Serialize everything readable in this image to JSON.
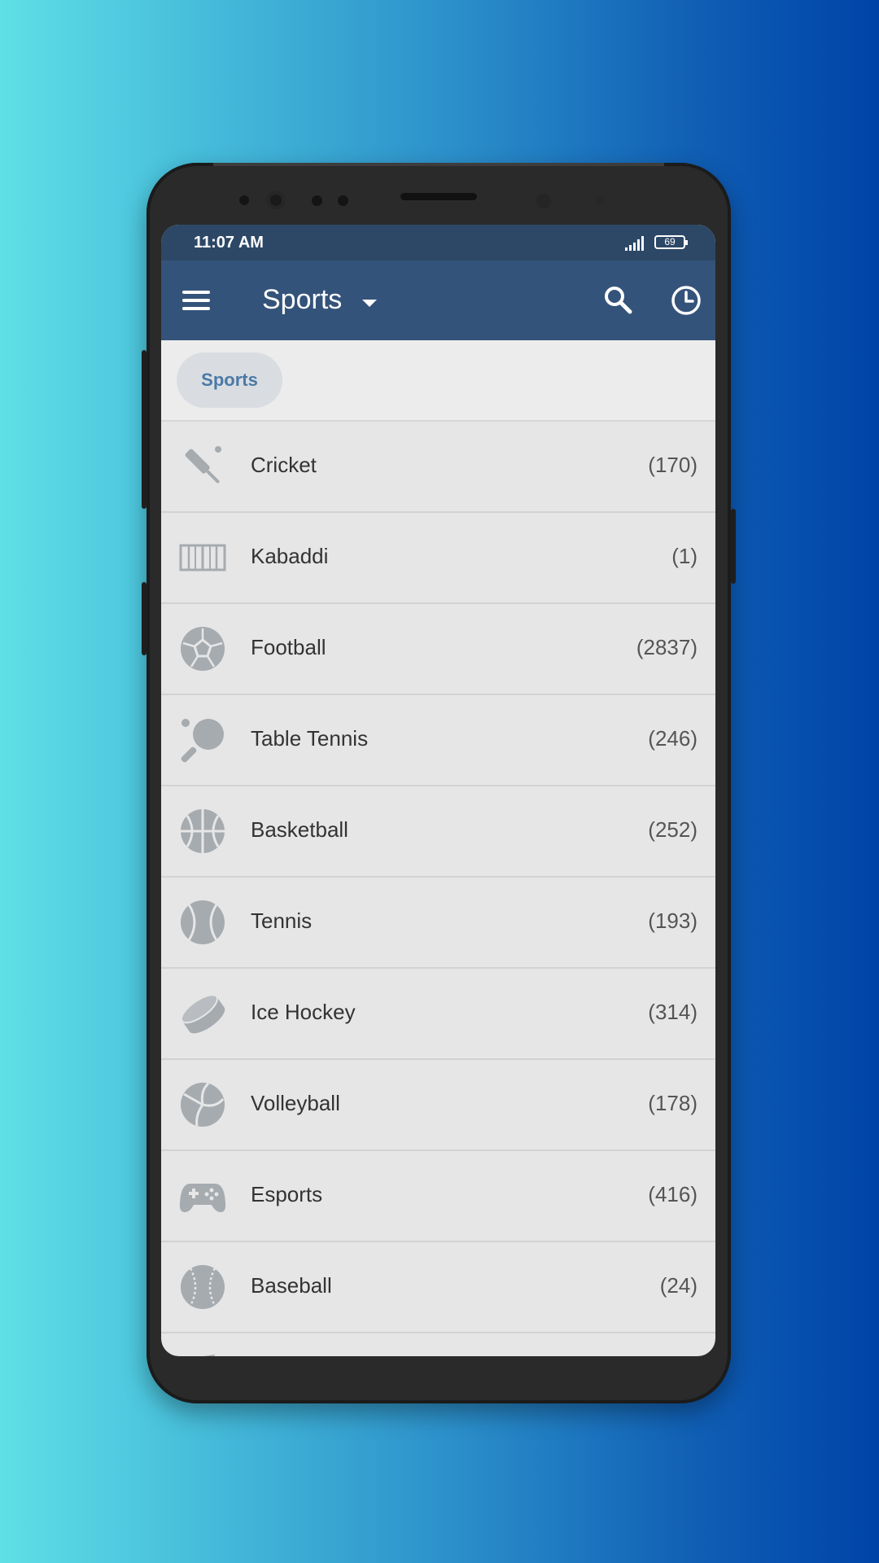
{
  "status_bar": {
    "time": "11:07 AM",
    "battery": "69"
  },
  "app_bar": {
    "title": "Sports",
    "icons": [
      "menu-icon",
      "chevron-down-icon",
      "search-icon",
      "history-icon"
    ]
  },
  "filter": {
    "chip_label": "Sports"
  },
  "sports": [
    {
      "name": "Cricket",
      "count": "(170)",
      "icon": "cricket-bat-icon"
    },
    {
      "name": "Kabaddi",
      "count": "(1)",
      "icon": "kabaddi-court-icon"
    },
    {
      "name": "Football",
      "count": "(2837)",
      "icon": "football-icon"
    },
    {
      "name": "Table Tennis",
      "count": "(246)",
      "icon": "table-tennis-icon"
    },
    {
      "name": "Basketball",
      "count": "(252)",
      "icon": "basketball-icon"
    },
    {
      "name": "Tennis",
      "count": "(193)",
      "icon": "tennis-ball-icon"
    },
    {
      "name": "Ice Hockey",
      "count": "(314)",
      "icon": "ice-hockey-puck-icon"
    },
    {
      "name": "Volleyball",
      "count": "(178)",
      "icon": "volleyball-icon"
    },
    {
      "name": "Esports",
      "count": "(416)",
      "icon": "gamepad-icon"
    },
    {
      "name": "Baseball",
      "count": "(24)",
      "icon": "baseball-icon"
    }
  ],
  "colors": {
    "app_bar": "#34537a",
    "status_bar": "#2d4866",
    "chip_text": "#4b79a6",
    "icon_gray": "#a6abb0",
    "list_background": "#e6e6e6"
  }
}
